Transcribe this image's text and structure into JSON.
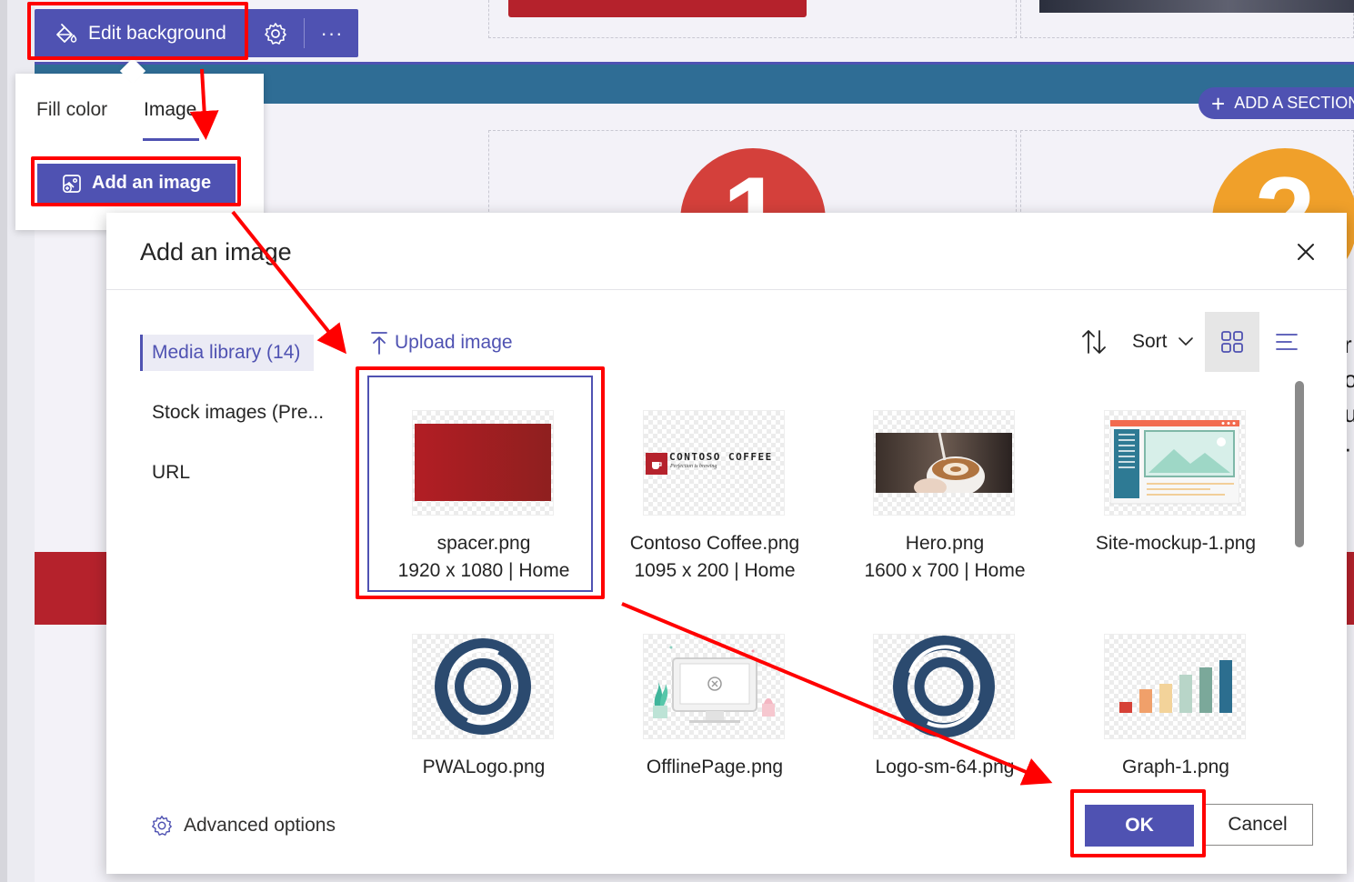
{
  "toolbar": {
    "edit_background_label": "Edit background",
    "more_label": "···"
  },
  "add_section": {
    "label": "ADD A SECTION"
  },
  "popover": {
    "tabs": [
      {
        "label": "Fill color",
        "selected": false
      },
      {
        "label": "Image",
        "selected": true
      }
    ],
    "add_image_label": "Add an image"
  },
  "dialog": {
    "title": "Add an image",
    "nav": [
      {
        "label": "Media library (14)",
        "selected": true
      },
      {
        "label": "Stock images (Pre..."
      },
      {
        "label": "URL"
      }
    ],
    "upload_label": "Upload image",
    "sort_label": "Sort",
    "view_mode": "grid",
    "images": [
      {
        "name": "spacer.png",
        "meta": "1920 x 1080 | Home",
        "selected": true,
        "thumb": "red-gradient"
      },
      {
        "name": "Contoso Coffee.png",
        "meta": "1095 x 200 | Home",
        "thumb": "contoso-logo",
        "logo_text": "CONTOSO COFFEE",
        "logo_tagline": "Perfection is brewing"
      },
      {
        "name": "Hero.png",
        "meta": "1600 x 700 | Home",
        "thumb": "latte-photo"
      },
      {
        "name": "Site-mockup-1.png",
        "meta": "",
        "thumb": "site-mockup"
      },
      {
        "name": "PWALogo.png",
        "meta": "",
        "thumb": "ring-logo"
      },
      {
        "name": "OfflinePage.png",
        "meta": "",
        "thumb": "offline-illustration"
      },
      {
        "name": "Logo-sm-64.png",
        "meta": "",
        "thumb": "ring-logo"
      },
      {
        "name": "Graph-1.png",
        "meta": "",
        "thumb": "bar-graph"
      }
    ],
    "advanced_label": "Advanced options",
    "ok_label": "OK",
    "cancel_label": "Cancel"
  },
  "background": {
    "circle_numbers": [
      "1",
      "2"
    ]
  },
  "colors": {
    "accent": "#4f52b2",
    "annotation": "#ff0000",
    "brand_red": "#b5222c",
    "band_blue": "#2f6d95"
  }
}
